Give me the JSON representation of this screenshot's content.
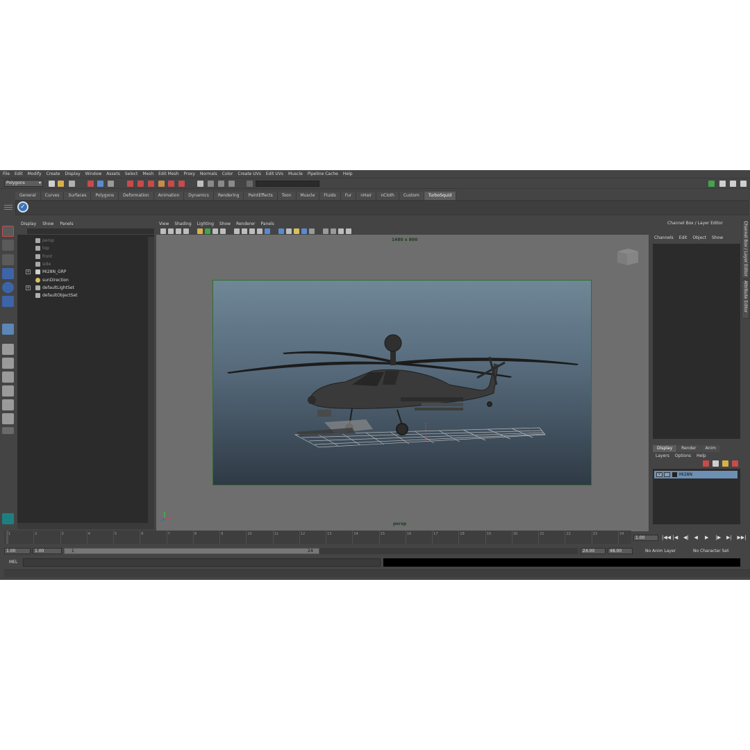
{
  "menubar": {
    "items": [
      "File",
      "Edit",
      "Modify",
      "Create",
      "Display",
      "Window",
      "Assets",
      "Select",
      "Mesh",
      "Edit Mesh",
      "Proxy",
      "Normals",
      "Color",
      "Create UVs",
      "Edit UVs",
      "Muscle",
      "Pipeline Cache",
      "Help"
    ]
  },
  "statusline": {
    "mode": "Polygons"
  },
  "shelf": {
    "tabs": [
      "General",
      "Curves",
      "Surfaces",
      "Polygons",
      "Deformation",
      "Animation",
      "Dynamics",
      "Rendering",
      "PaintEffects",
      "Toon",
      "Muscle",
      "Fluids",
      "Fur",
      "nHair",
      "nCloth",
      "Custom",
      "TurboSquid"
    ],
    "active_tab": "TurboSquid",
    "button_glyph": "✓"
  },
  "outliner": {
    "menu": [
      "Display",
      "Show",
      "Panels"
    ],
    "items": [
      {
        "label": "persp",
        "dim": true,
        "expandable": false,
        "indent": 1,
        "icon": "camera-icon"
      },
      {
        "label": "top",
        "dim": true,
        "expandable": false,
        "indent": 1,
        "icon": "camera-icon"
      },
      {
        "label": "front",
        "dim": true,
        "expandable": false,
        "indent": 1,
        "icon": "camera-icon"
      },
      {
        "label": "side",
        "dim": true,
        "expandable": false,
        "indent": 1,
        "icon": "camera-icon"
      },
      {
        "label": "Mi28N_GRP",
        "dim": false,
        "expandable": true,
        "indent": 1,
        "icon": "group-icon"
      },
      {
        "label": "sunDirection",
        "dim": false,
        "expandable": false,
        "indent": 1,
        "icon": "light-icon"
      },
      {
        "label": "defaultLightSet",
        "dim": false,
        "expandable": true,
        "indent": 0,
        "icon": "set-icon"
      },
      {
        "label": "defaultObjectSet",
        "dim": false,
        "expandable": false,
        "indent": 0,
        "icon": "set-icon"
      }
    ]
  },
  "viewport": {
    "menu": [
      "View",
      "Shading",
      "Lighting",
      "Show",
      "Renderer",
      "Panels"
    ],
    "resolution": "1480 x 800",
    "camera": "persp"
  },
  "channel_box": {
    "title": "Channel Box / Layer Editor",
    "menu": [
      "Channels",
      "Edit",
      "Object",
      "Show"
    ]
  },
  "layer_editor": {
    "tabs": [
      "Display",
      "Render",
      "Anim"
    ],
    "active_tab": "Display",
    "menu": [
      "Layers",
      "Options",
      "Help"
    ],
    "layer": {
      "visible": "V",
      "name": "Mi28N"
    }
  },
  "side_tabs": [
    "Channel Box / Layer Editor",
    "Attribute Editor"
  ],
  "timeslider": {
    "ticks": [
      "1",
      "2",
      "3",
      "4",
      "5",
      "6",
      "7",
      "8",
      "9",
      "10",
      "11",
      "12",
      "13",
      "14",
      "15",
      "16",
      "17",
      "18",
      "19",
      "20",
      "21",
      "22",
      "23",
      "24"
    ],
    "current_frame": "1.00",
    "playback_glyphs": [
      "|◀◀",
      "|◀",
      "◀|",
      "◀",
      "▶",
      "|▶",
      "▶|",
      "▶▶|"
    ]
  },
  "rangeslider": {
    "start": "1.00",
    "playback_start": "1.00",
    "range_in": "1",
    "range_out": "24",
    "playback_end": "24.00",
    "end": "48.00",
    "anim_layer": "No Anim Layer",
    "character_set": "No Character Set"
  },
  "commandline": {
    "label": "MEL"
  }
}
